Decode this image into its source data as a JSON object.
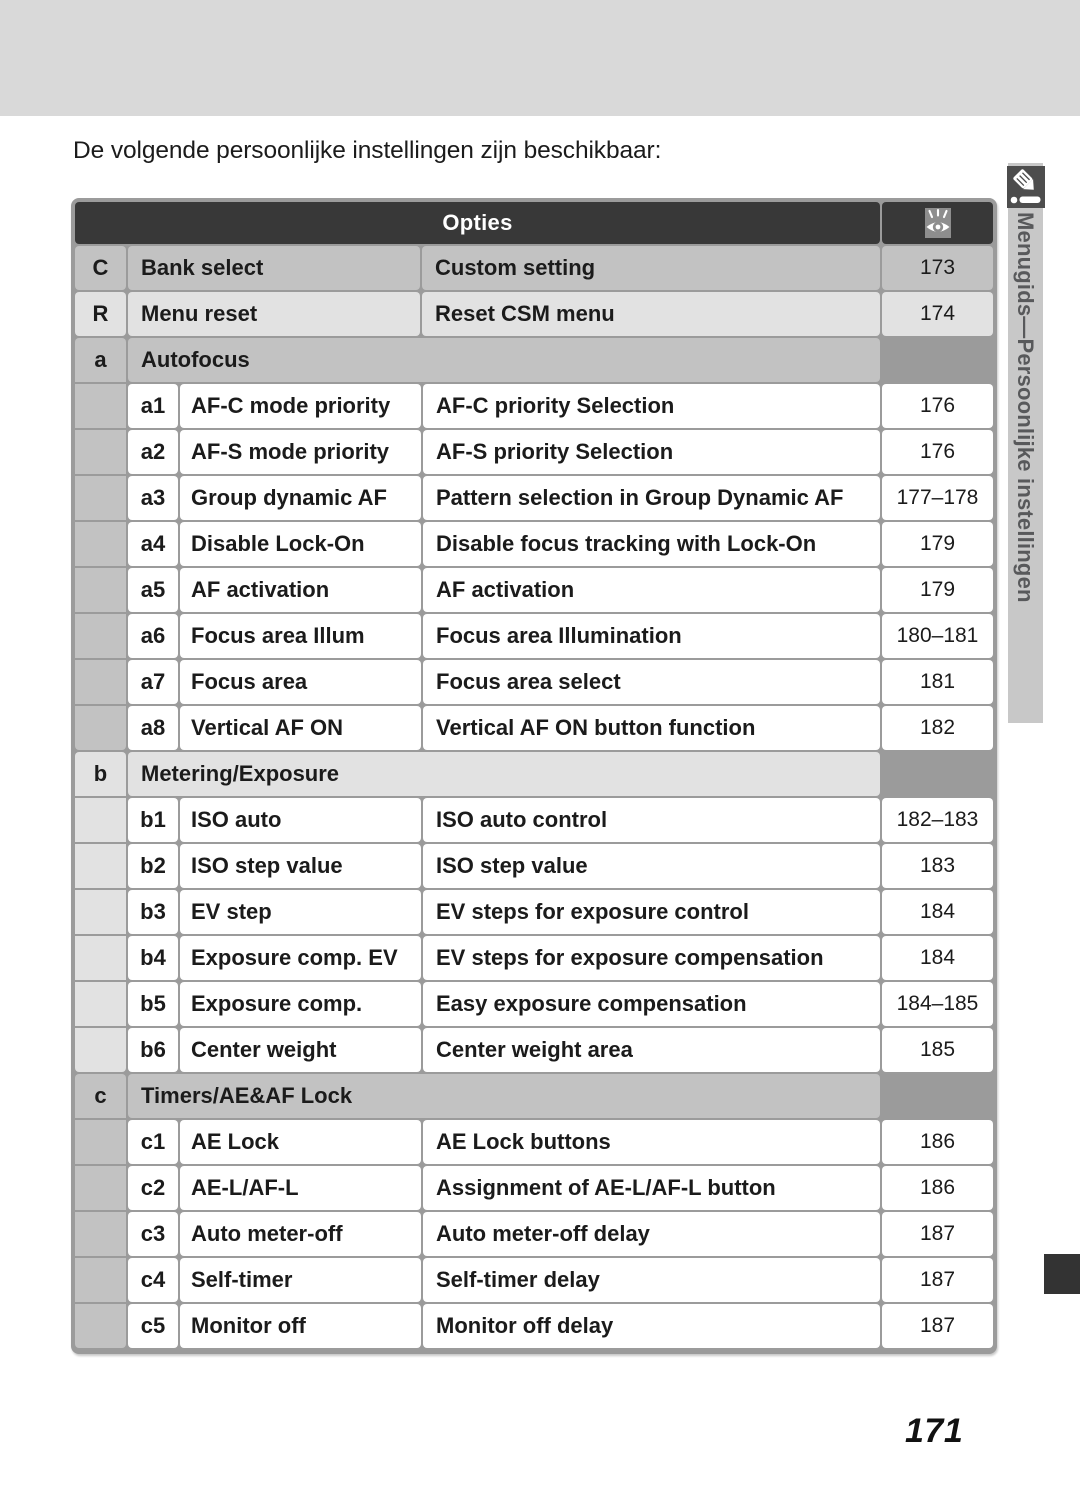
{
  "intro": "De volgende persoonlijke instellingen zijn beschikbaar:",
  "sidebar": {
    "icon": "pencil-icon",
    "label": "Menugids—Persoonlijke instellingen"
  },
  "table": {
    "header": {
      "options_label": "Opties",
      "page_icon": "eye-reference-icon"
    },
    "top_rows": [
      {
        "code": "C",
        "name": "Bank select",
        "desc": "Custom setting",
        "page": "173"
      },
      {
        "code": "R",
        "name": "Menu reset",
        "desc": "Reset CSM menu",
        "page": "174"
      }
    ],
    "sections": [
      {
        "code": "a",
        "title": "Autofocus",
        "rows": [
          {
            "code": "a1",
            "name": "AF-C mode priority",
            "desc": "AF-C priority Selection",
            "page": "176"
          },
          {
            "code": "a2",
            "name": "AF-S mode priority",
            "desc": "AF-S priority Selection",
            "page": "176"
          },
          {
            "code": "a3",
            "name": "Group dynamic AF",
            "desc": "Pattern selection in Group Dynamic AF",
            "page": "177–178"
          },
          {
            "code": "a4",
            "name": "Disable Lock-On",
            "desc": "Disable focus tracking with Lock-On",
            "page": "179"
          },
          {
            "code": "a5",
            "name": "AF activation",
            "desc": "AF activation",
            "page": "179"
          },
          {
            "code": "a6",
            "name": "Focus area Illum",
            "desc": "Focus area Illumination",
            "page": "180–181"
          },
          {
            "code": "a7",
            "name": "Focus area",
            "desc": "Focus area select",
            "page": "181"
          },
          {
            "code": "a8",
            "name": "Vertical AF ON",
            "desc": "Vertical AF ON button function",
            "page": "182"
          }
        ]
      },
      {
        "code": "b",
        "title": "Metering/Exposure",
        "rows": [
          {
            "code": "b1",
            "name": "ISO auto",
            "desc": "ISO auto control",
            "page": "182–183"
          },
          {
            "code": "b2",
            "name": "ISO step value",
            "desc": "ISO step value",
            "page": "183"
          },
          {
            "code": "b3",
            "name": "EV step",
            "desc": "EV steps for exposure control",
            "page": "184"
          },
          {
            "code": "b4",
            "name": "Exposure comp. EV",
            "desc": "EV steps for exposure compensation",
            "page": "184"
          },
          {
            "code": "b5",
            "name": "Exposure comp.",
            "desc": "Easy exposure compensation",
            "page": "184–185"
          },
          {
            "code": "b6",
            "name": "Center weight",
            "desc": "Center weight area",
            "page": "185"
          }
        ]
      },
      {
        "code": "c",
        "title": "Timers/AE&AF Lock",
        "rows": [
          {
            "code": "c1",
            "name": "AE Lock",
            "desc": "AE Lock buttons",
            "page": "186"
          },
          {
            "code": "c2",
            "name": "AE-L/AF-L",
            "desc": "Assignment of AE-L/AF-L button",
            "page": "186"
          },
          {
            "code": "c3",
            "name": "Auto meter-off",
            "desc": "Auto meter-off delay",
            "page": "187"
          },
          {
            "code": "c4",
            "name": "Self-timer",
            "desc": "Self-timer delay",
            "page": "187"
          },
          {
            "code": "c5",
            "name": "Monitor off",
            "desc": "Monitor off delay",
            "page": "187"
          }
        ]
      }
    ]
  },
  "folio": "171",
  "colors": {
    "band": "#d9d9d9",
    "header_dark": "#383838",
    "frame": "#9b9b9b",
    "row_dark": "#c2c2c2",
    "row_light": "#e2e2e2",
    "sidebar": "#c8c8c8",
    "sidebar_text": "#58595b"
  }
}
